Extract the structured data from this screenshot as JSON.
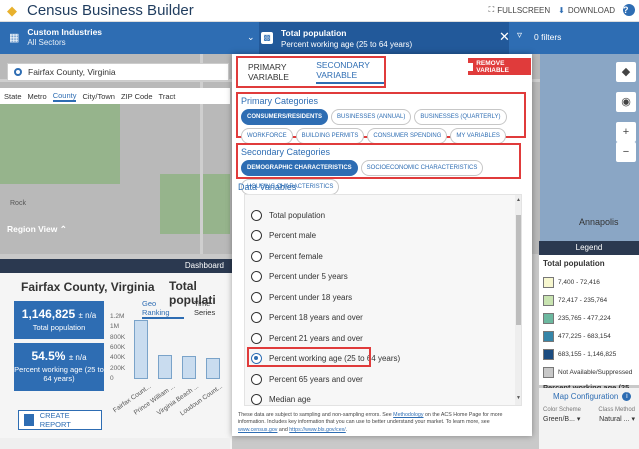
{
  "app": {
    "title": "Census Business Builder"
  },
  "topbar": {
    "fullscreen": "FULLSCREEN",
    "download": "DOWNLOAD",
    "help": "?"
  },
  "filterbar": {
    "industries_title": "Custom Industries",
    "industries_sub": "All Sectors",
    "variable_title": "Total population",
    "variable_sub": "Percent working age (25 to 64 years)",
    "filters": "0 filters"
  },
  "search": {
    "value": "Fairfax County, Virginia"
  },
  "geotypes": [
    "State",
    "Metro",
    "County",
    "City/Town",
    "ZIP Code",
    "Tract"
  ],
  "geotype_active": "County",
  "map": {
    "region_view": "Region View",
    "annapolis": "Annapolis",
    "rock": "Rock"
  },
  "modal": {
    "tab_primary": "PRIMARY VARIABLE",
    "tab_secondary": "SECONDARY VARIABLE",
    "remove": "REMOVE VARIABLE",
    "primary_title": "Primary Categories",
    "primary_pills": [
      "CONSUMERS/RESIDENTS",
      "BUSINESSES (ANNUAL)",
      "BUSINESSES (QUARTERLY)",
      "WORKFORCE",
      "BUILDING PERMITS",
      "CONSUMER SPENDING",
      "MY VARIABLES"
    ],
    "secondary_title": "Secondary Categories",
    "secondary_pills": [
      "DEMOGRAPHIC CHARACTERISTICS",
      "SOCIOECONOMIC CHARACTERISTICS",
      "HOUSING CHARACTERISTICS"
    ],
    "data_vars_title": "Data Variables",
    "variables": [
      "Total population",
      "Percent male",
      "Percent female",
      "Percent under 5 years",
      "Percent under 18 years",
      "Percent 18 years and over",
      "Percent 21 years and over",
      "Percent working age (25 to 64 years)",
      "Percent 65 years and over",
      "Median age"
    ],
    "selected_variable": "Percent working age (25 to 64 years)",
    "note_a": "These data are subject to sampling and non-sampling errors. See ",
    "note_link1": "Methodology",
    "note_b": " on the ACS Home Page for more information. Includes key information that you can use to better understand your market. To learn more, see ",
    "note_link2": "www.census.gov",
    "note_c": " and ",
    "note_link3": "https://www.bls.gov/cex/",
    "note_d": "."
  },
  "dashboard": {
    "header": "Dashboard",
    "county": "Fairfax County, Virginia",
    "cards": [
      {
        "value": "1,146,825",
        "moe": "± n/a",
        "label": "Total population"
      },
      {
        "value": "54.5%",
        "moe": "± n/a",
        "label": "Percent working age (25 to 64 years)"
      }
    ],
    "chart_title": "Total populati",
    "tabs": [
      "Geo Ranking",
      "Time Series"
    ],
    "create_report": "CREATE REPORT"
  },
  "chart_data": {
    "type": "bar",
    "title": "Total populati",
    "categories": [
      "Fairfax Count...",
      "Prince William ...",
      "Virginia Beach ...",
      "Loudoun Count..."
    ],
    "values": [
      1146825,
      470000,
      450000,
      410000
    ],
    "yticks": [
      "1.2M",
      "1M",
      "800K",
      "600K",
      "400K",
      "200K",
      "0"
    ],
    "ylim": [
      0,
      1200000
    ]
  },
  "legend": {
    "header": "Legend",
    "title": "Total population",
    "rows": [
      {
        "label": "7,400 - 72,416",
        "color": "#f7f7cf"
      },
      {
        "label": "72,417 - 235,764",
        "color": "#c8e3b0"
      },
      {
        "label": "235,765 - 477,224",
        "color": "#6cb89f"
      },
      {
        "label": "477,225 - 683,154",
        "color": "#3585a8"
      },
      {
        "label": "683,155 - 1,146,825",
        "color": "#1b4c80"
      },
      {
        "label": "Not Available/Suppressed",
        "color": "#c8c8c8"
      }
    ],
    "cut": "Percent working age (25"
  },
  "mapcfg": {
    "title": "Map Configuration",
    "color_scheme_label": "Color Scheme",
    "class_method_label": "Class Method",
    "color_scheme": "Green/B...",
    "class_method": "Natural ..."
  }
}
